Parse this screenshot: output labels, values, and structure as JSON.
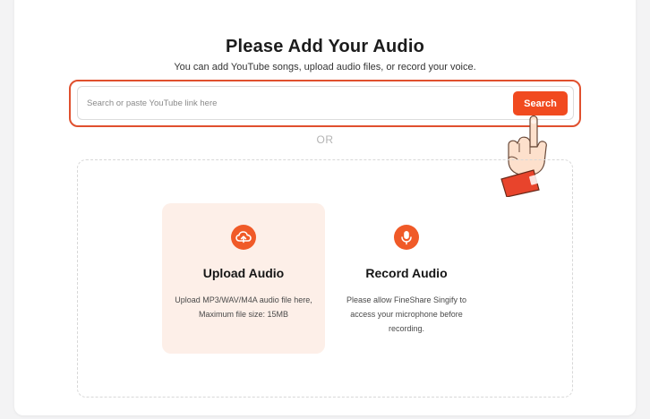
{
  "header": {
    "title": "Please Add Your Audio",
    "subtitle": "You can add YouTube songs, upload audio files, or record your voice."
  },
  "search": {
    "placeholder": "Search or paste YouTube link here",
    "value": "",
    "button_label": "Search"
  },
  "separator": "OR",
  "options": {
    "upload": {
      "icon": "cloud-upload-icon",
      "title": "Upload Audio",
      "description": "Upload MP3/WAV/M4A audio file here, Maximum file size: 15MB"
    },
    "record": {
      "icon": "microphone-icon",
      "title": "Record Audio",
      "description": "Please allow FineShare Singify to access your microphone before recording."
    }
  },
  "colors": {
    "accent": "#f14a1f",
    "highlight_border": "#e0502e",
    "upload_bg": "#fdefe8"
  }
}
